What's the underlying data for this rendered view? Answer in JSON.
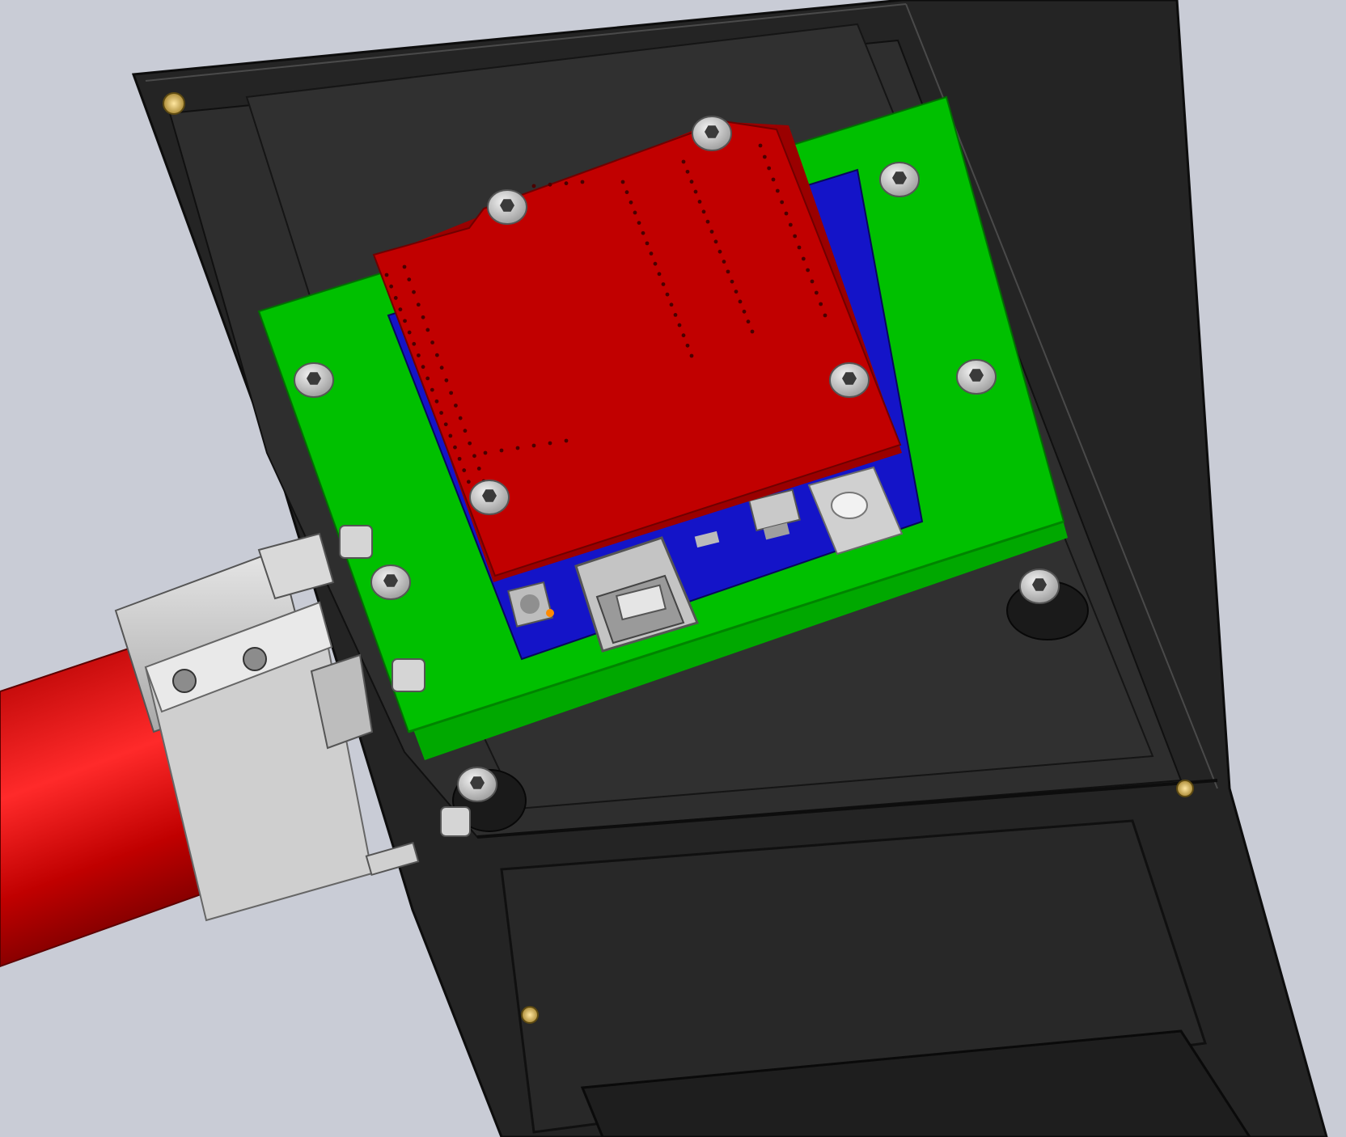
{
  "scene": {
    "title": "",
    "background_color": "#c9ccd6",
    "colors": {
      "enclosure": "#2b2b2b",
      "enclosure_edge": "#111111",
      "mounting_plate": "#00b800",
      "shield_board": "#c00000",
      "base_board": "#1010b0",
      "standoff": "#c8c8c8",
      "brass_insert": "#b8963a",
      "tube": "#d40000",
      "clamp": "#d8d8d8"
    },
    "components": [
      {
        "name": "enclosure-body",
        "label": ""
      },
      {
        "name": "mounting-plate",
        "label": ""
      },
      {
        "name": "base-board",
        "label": ""
      },
      {
        "name": "shield-board",
        "label": ""
      },
      {
        "name": "usb-b-connector",
        "label": ""
      },
      {
        "name": "dc-power-jack",
        "label": ""
      },
      {
        "name": "voltage-regulator",
        "label": ""
      },
      {
        "name": "pipe-clamp",
        "label": ""
      },
      {
        "name": "support-tube",
        "label": ""
      }
    ]
  }
}
